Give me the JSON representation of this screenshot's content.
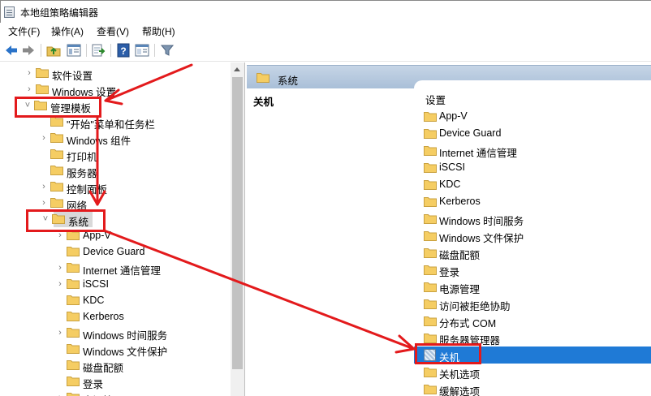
{
  "window": {
    "title": "本地组策略编辑器"
  },
  "menu": [
    {
      "label": "文件(F)"
    },
    {
      "label": "操作(A)"
    },
    {
      "label": "查看(V)"
    },
    {
      "label": "帮助(H)"
    }
  ],
  "toolbar": {
    "buttons": [
      {
        "icon": "back-arrow-icon"
      },
      {
        "icon": "forward-arrow-icon"
      },
      {
        "icon": "up-folder-icon"
      },
      {
        "icon": "show-hide-tree-icon"
      },
      {
        "icon": "export-list-icon"
      },
      {
        "icon": "help-icon"
      },
      {
        "icon": "properties-icon"
      },
      {
        "icon": "filter-icon"
      }
    ]
  },
  "tree": {
    "items": [
      {
        "label": "软件设置",
        "expander": ">",
        "selected": false
      },
      {
        "label": "Windows 设置",
        "expander": ">",
        "selected": false
      },
      {
        "label": "管理模板",
        "expander": "v",
        "selected": false
      },
      {
        "label": "\"开始\"菜单和任务栏",
        "expander": "",
        "selected": false
      },
      {
        "label": "Windows 组件",
        "expander": ">",
        "selected": false
      },
      {
        "label": "打印机",
        "expander": "",
        "selected": false
      },
      {
        "label": "服务器",
        "expander": "",
        "selected": false
      },
      {
        "label": "控制面板",
        "expander": ">",
        "selected": false
      },
      {
        "label": "网络",
        "expander": ">",
        "selected": false
      },
      {
        "label": "系统",
        "expander": "v",
        "selected": true
      },
      {
        "label": "App-V",
        "expander": ">",
        "selected": false
      },
      {
        "label": "Device Guard",
        "expander": "",
        "selected": false
      },
      {
        "label": "Internet 通信管理",
        "expander": ">",
        "selected": false
      },
      {
        "label": "iSCSI",
        "expander": ">",
        "selected": false
      },
      {
        "label": "KDC",
        "expander": "",
        "selected": false
      },
      {
        "label": "Kerberos",
        "expander": "",
        "selected": false
      },
      {
        "label": "Windows 时间服务",
        "expander": ">",
        "selected": false
      },
      {
        "label": "Windows 文件保护",
        "expander": "",
        "selected": false
      },
      {
        "label": "磁盘配额",
        "expander": "",
        "selected": false
      },
      {
        "label": "登录",
        "expander": "",
        "selected": false
      },
      {
        "label": "电源管理",
        "expander": ">",
        "selected": false
      }
    ]
  },
  "right_pane": {
    "header": "系统",
    "selected_title": "关机",
    "column_header": "设置",
    "items": [
      {
        "label": "App-V",
        "type": "folder"
      },
      {
        "label": "Device Guard",
        "type": "folder"
      },
      {
        "label": "Internet 通信管理",
        "type": "folder"
      },
      {
        "label": "iSCSI",
        "type": "folder"
      },
      {
        "label": "KDC",
        "type": "folder"
      },
      {
        "label": "Kerberos",
        "type": "folder"
      },
      {
        "label": "Windows 时间服务",
        "type": "folder"
      },
      {
        "label": "Windows 文件保护",
        "type": "folder"
      },
      {
        "label": "磁盘配额",
        "type": "folder"
      },
      {
        "label": "登录",
        "type": "folder"
      },
      {
        "label": "电源管理",
        "type": "folder"
      },
      {
        "label": "访问被拒绝协助",
        "type": "folder"
      },
      {
        "label": "分布式 COM",
        "type": "folder"
      },
      {
        "label": "服务器管理器",
        "type": "folder"
      },
      {
        "label": "关机",
        "type": "setting",
        "selected": true
      },
      {
        "label": "关机选项",
        "type": "folder"
      },
      {
        "label": "缓解选项",
        "type": "folder"
      }
    ]
  },
  "colors": {
    "annotation_red": "#e31a1c",
    "selection_blue": "#1f7ad6",
    "folder_yellow": "#f5cd63",
    "header_blue": "#b4c8de"
  }
}
